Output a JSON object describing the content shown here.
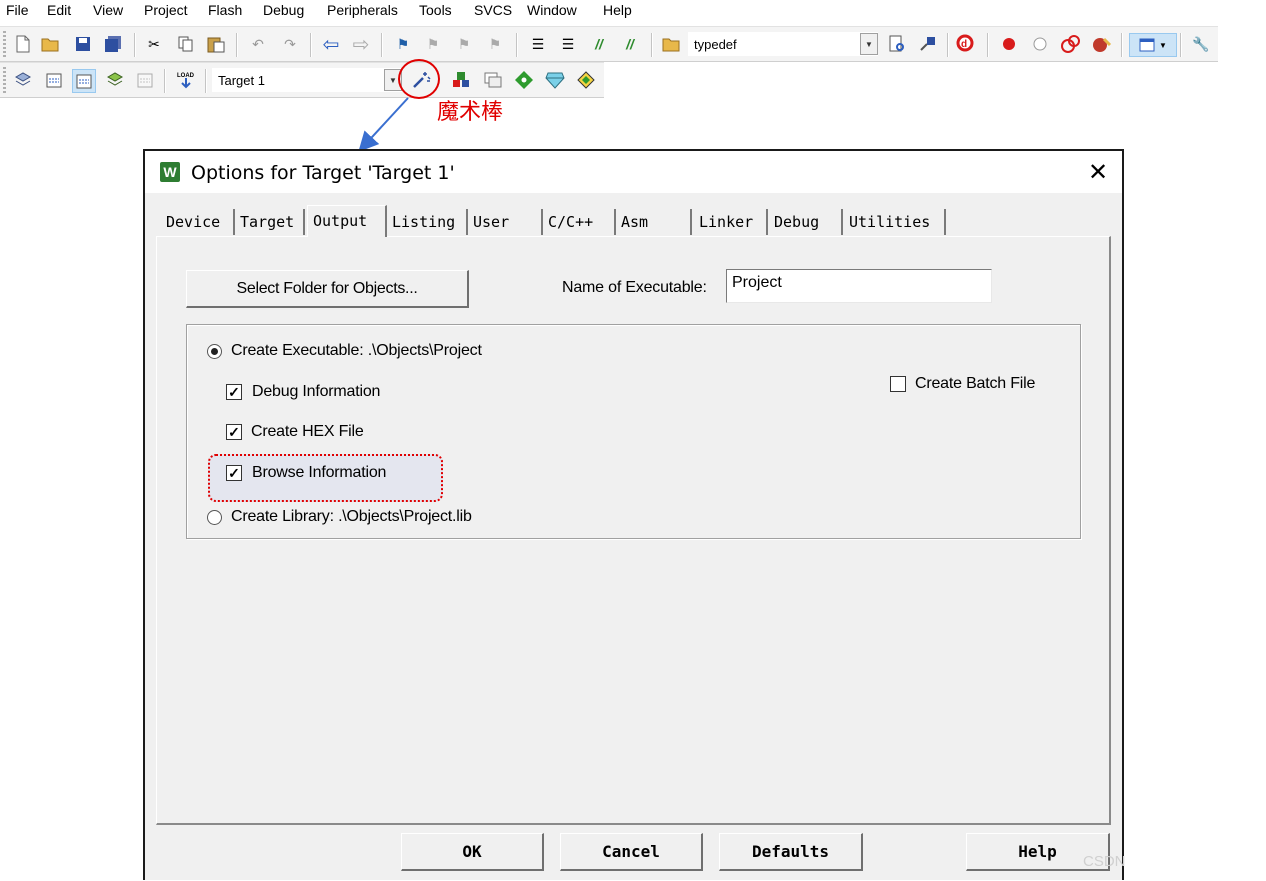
{
  "menu": [
    "File",
    "Edit",
    "View",
    "Project",
    "Flash",
    "Debug",
    "Peripherals",
    "Tools",
    "SVCS",
    "Window",
    "Help"
  ],
  "toolbar": {
    "find_combo_value": "typedef",
    "target_combo_value": "Target 1"
  },
  "annotation": {
    "label": "魔术棒"
  },
  "dialog": {
    "title": "Options for Target 'Target 1'",
    "tabs": [
      "Device",
      "Target",
      "Output",
      "Listing",
      "User",
      "C/C++",
      "Asm",
      "Linker",
      "Debug",
      "Utilities"
    ],
    "active_tab": "Output",
    "select_folder_button": "Select Folder for Objects...",
    "name_exec_label": "Name of Executable:",
    "name_exec_value": "Project",
    "create_exec_label": "Create Executable:  .\\Objects\\Project",
    "debug_info_label": "Debug Information",
    "create_hex_label": "Create HEX File",
    "browse_info_label": "Browse Information",
    "create_lib_label": "Create Library:  .\\Objects\\Project.lib",
    "create_batch_label": "Create Batch File",
    "buttons": {
      "ok": "OK",
      "cancel": "Cancel",
      "defaults": "Defaults",
      "help": "Help"
    },
    "watermark": "CSDN"
  },
  "colors": {
    "annotation": "#e00000",
    "arrow": "#3a6fd0",
    "dialog_bg": "#f0f0f0"
  }
}
